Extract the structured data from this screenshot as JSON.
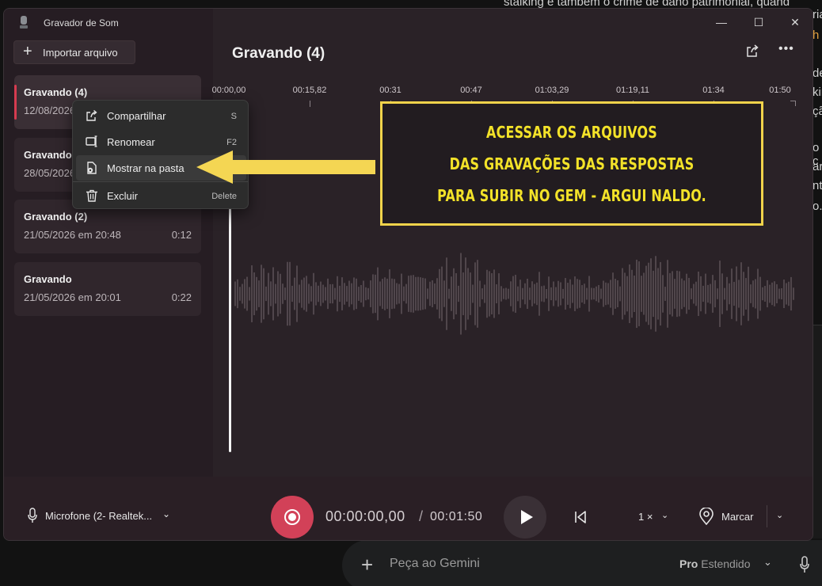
{
  "background": {
    "browser_line": "stalking e também o crime de dano patrimonial, quand",
    "right_fragments": [
      {
        "text": "ria",
        "orange": false
      },
      {
        "text": "h",
        "orange": true
      },
      {
        "text": "de",
        "orange": false
      },
      {
        "text": "kin",
        "orange": false
      },
      {
        "text": "çã",
        "orange": false
      },
      {
        "text": "o c",
        "orange": false
      },
      {
        "text": "ar",
        "orange": false
      },
      {
        "text": "nt",
        "orange": false
      },
      {
        "text": "o.",
        "orange": false
      }
    ]
  },
  "gemini": {
    "placeholder": "Peça ao Gemini",
    "mode_pro": "Pro",
    "mode_ext": "Estendido",
    "plus_icon": "plus-icon",
    "mic_icon": "mic-icon"
  },
  "window": {
    "title": "Gravador de Som",
    "controls": {
      "minimize": "—",
      "maximize": "☐",
      "close": "✕"
    }
  },
  "sidebar": {
    "import_label": "Importar arquivo",
    "recordings": [
      {
        "name": "Gravando (4)",
        "date": "12/08/2026",
        "duration": ""
      },
      {
        "name": "Gravando",
        "date": "28/05/2026",
        "duration": ""
      },
      {
        "name": "Gravando (2)",
        "date": "21/05/2026 em 20:48",
        "duration": "0:12"
      },
      {
        "name": "Gravando",
        "date": "21/05/2026 em 20:01",
        "duration": "0:22"
      }
    ]
  },
  "context_menu": {
    "items": [
      {
        "label": "Compartilhar",
        "shortcut": "S",
        "icon": "share-icon"
      },
      {
        "label": "Renomear",
        "shortcut": "F2",
        "icon": "rename-icon"
      },
      {
        "label": "Mostrar na pasta",
        "shortcut": "",
        "icon": "folder-show-icon"
      },
      {
        "label": "Excluir",
        "shortcut": "Delete",
        "icon": "trash-icon"
      }
    ]
  },
  "main": {
    "title": "Gravando (4)",
    "timeline": [
      "00:00,00",
      "00:15,82",
      "00:31",
      "00:47",
      "01:03,29",
      "01:19,11",
      "01:34",
      "01:50"
    ]
  },
  "annotation": {
    "lines": [
      "ACESSAR OS ARQUIVOS",
      "DAS GRAVAÇÕES DAS RESPOSTAS",
      "PARA SUBIR NO GEM - ARGUI NALDO."
    ],
    "color": "#f3e229"
  },
  "controls": {
    "microphone": "Microfone (2- Realtek...",
    "current_time": "00:00:00,00",
    "separator": "/",
    "total_time": "00:01:50",
    "speed": "1 ×",
    "mark": "Marcar",
    "record_color": "#d24158"
  }
}
